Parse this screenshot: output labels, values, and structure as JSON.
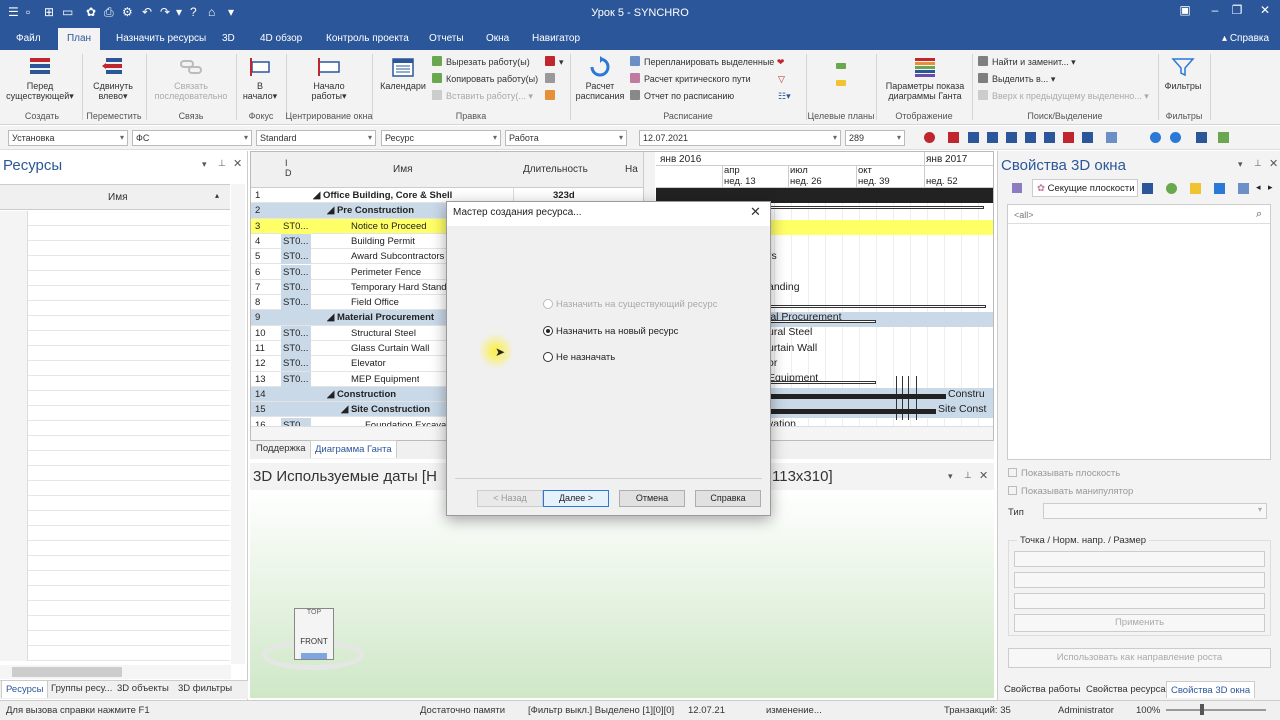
{
  "window": {
    "title": "Урок 5 - SYNCHRO"
  },
  "menu": {
    "items": [
      "Файл",
      "План",
      "Назначить ресурсы",
      "3D",
      "4D обзор",
      "Контроль проекта",
      "Отчеты",
      "Окна",
      "Навигатор"
    ],
    "help": "Справка"
  },
  "ribbon": {
    "before_existing": "Перед существующей",
    "shift_left": "Сдвинуть влево",
    "link_sequential": "Связать последовательно",
    "to_start": "В начало",
    "work_start": "Начало работы",
    "calendars": "Календари",
    "cut_work": "Вырезать работу(ы)",
    "copy_work": "Копировать работу(ы)",
    "paste_work": "Вставить работу(...",
    "schedule_calc": "Расчет расписания",
    "reschedule_selected": "Перепланировать выделенные",
    "critical_path": "Расчет критического пути",
    "schedule_report": "Отчет по расписанию",
    "gantt_params": "Параметры показа диаграммы Ганта",
    "find_replace": "Найти и заменит...",
    "select_in": "Выделить в...",
    "up_prev_selection": "Вверх к предыдущему выделенно...",
    "filters": "Фильтры",
    "groups": {
      "create": "Создать",
      "move": "Переместить",
      "link": "Связь",
      "focus": "Фокус",
      "center_window": "Центрирование окна",
      "edit": "Правка",
      "schedule": "Расписание",
      "target_plans": "Целевые планы",
      "display": "Отображение",
      "search": "Поиск/Выделение",
      "filters": "Фильтры"
    }
  },
  "toolbar": {
    "phase": "Установка",
    "fs": "ФС",
    "standard": "Standard",
    "resource": "Ресурс",
    "work": "Работа",
    "date": "12.07.2021",
    "days": "289"
  },
  "resources_panel": {
    "title": "Ресурсы",
    "col_name": "Имя",
    "tabs": [
      "Ресурсы",
      "Группы ресу...",
      "3D объекты",
      "3D фильтры"
    ]
  },
  "gantt": {
    "col_id": "I D",
    "col_name": "Имя",
    "col_duration": "Длительность",
    "col_start": "На",
    "timeline_years": [
      "янв 2016",
      "янв 2017"
    ],
    "timeline_months": [
      "апр",
      "июл",
      "окт"
    ],
    "timeline_weeks": [
      "нед. 13",
      "нед. 26",
      "нед. 39",
      "нед. 52"
    ],
    "rows": [
      {
        "n": "1",
        "code": "",
        "name": "Office Building, Core & Shell",
        "dur": "323d",
        "level": 0,
        "summary": true
      },
      {
        "n": "2",
        "code": "",
        "name": "Pre Construction",
        "dur": "",
        "level": 1,
        "summary": true
      },
      {
        "n": "3",
        "code": "ST0...",
        "name": "Notice to Proceed",
        "dur": "",
        "level": 2,
        "highlight": true
      },
      {
        "n": "4",
        "code": "ST0...",
        "name": "Building Permit",
        "dur": "",
        "level": 2
      },
      {
        "n": "5",
        "code": "ST0...",
        "name": "Award Subcontractors",
        "dur": "",
        "level": 2
      },
      {
        "n": "6",
        "code": "ST0...",
        "name": "Perimeter Fence",
        "dur": "",
        "level": 2
      },
      {
        "n": "7",
        "code": "ST0...",
        "name": "Temporary Hard Standing",
        "dur": "",
        "level": 2
      },
      {
        "n": "8",
        "code": "ST0...",
        "name": "Field Office",
        "dur": "",
        "level": 2
      },
      {
        "n": "9",
        "code": "",
        "name": "Material Procurement",
        "dur": "",
        "level": 1,
        "summary": true
      },
      {
        "n": "10",
        "code": "ST0...",
        "name": "Structural Steel",
        "dur": "",
        "level": 2
      },
      {
        "n": "11",
        "code": "ST0...",
        "name": "Glass Curtain Wall",
        "dur": "",
        "level": 2
      },
      {
        "n": "12",
        "code": "ST0...",
        "name": "Elevator",
        "dur": "",
        "level": 2
      },
      {
        "n": "13",
        "code": "ST0...",
        "name": "MEP Equipment",
        "dur": "",
        "level": 2
      },
      {
        "n": "14",
        "code": "",
        "name": "Construction",
        "dur": "",
        "level": 1,
        "summary": true
      },
      {
        "n": "15",
        "code": "",
        "name": "Site Construction",
        "dur": "",
        "level": 2,
        "summary": true
      },
      {
        "n": "16",
        "code": "ST0...",
        "name": "Foundation Excavation",
        "dur": "",
        "level": 3
      }
    ],
    "bar_labels": [
      "rs",
      "anding",
      "ial Procurement",
      "ural Steel",
      "urtain Wall",
      "or",
      "Equipment",
      "Constru",
      "Site Const",
      "vation"
    ],
    "tabs": [
      "Поддержка",
      "Диаграмма Ганта"
    ]
  },
  "viewer3d": {
    "title": "3D Используемые даты [Н",
    "title_suffix": "113x310]",
    "cube_top": "TOP",
    "cube_front": "FRONT"
  },
  "props_panel": {
    "title": "Свойства 3D окна",
    "tab_sections": "Секущие плоскости",
    "filter_value": "<all>",
    "show_plane": "Показывать плоскость",
    "show_manipulator": "Показывать манипулятор",
    "type_label": "Тип",
    "point_group": "Точка / Норм. напр. / Размер",
    "apply": "Применить",
    "use_as_growth": "Использовать как направление роста",
    "tabs": [
      "Свойства работы",
      "Свойства ресурса",
      "Свойства 3D окна"
    ]
  },
  "dialog": {
    "title": "Мастер создания ресурса...",
    "options": [
      {
        "label": "Назначить на существующий ресурс",
        "selected": false,
        "disabled": true
      },
      {
        "label": "Назначить на новый ресурс",
        "selected": true,
        "disabled": false
      },
      {
        "label": "Не назначать",
        "selected": false,
        "disabled": false
      }
    ],
    "back": "< Назад",
    "next": "Далее >",
    "cancel": "Отмена",
    "help": "Справка"
  },
  "status": {
    "help_hint": "Для вызова справки нажмите F1",
    "memory": "Достаточно памяти",
    "filter": "[Фильтр выкл.] Выделено [1][0][0]",
    "date": "12.07.21",
    "change": "изменение...",
    "transactions": "Транзакций: 35",
    "user": "Administrator",
    "zoom": "100%"
  },
  "colors": {
    "accent": "#2b579a",
    "highlight_row": "#ffff66",
    "summary_row": "#c9d9e8"
  }
}
